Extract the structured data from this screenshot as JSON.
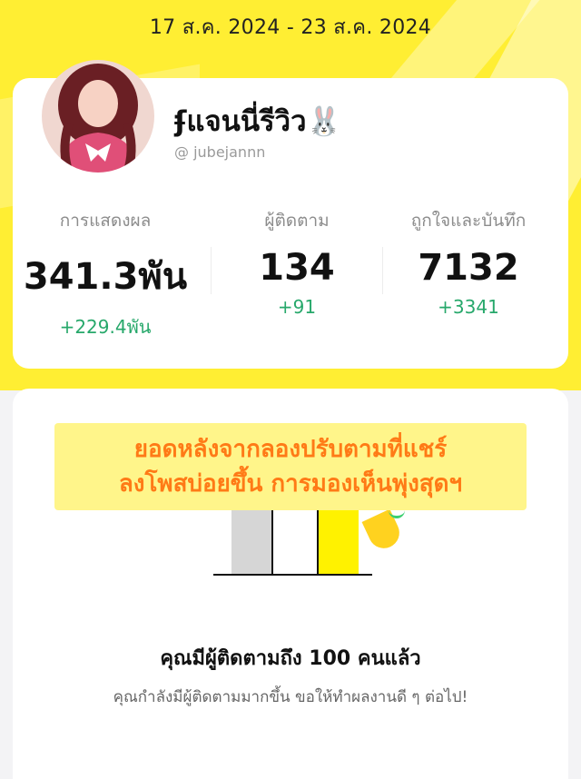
{
  "header": {
    "date_range": "17 ส.ค. 2024 - 23 ส.ค. 2024"
  },
  "profile": {
    "display_name": "ʄแจนนี่รีวิว🐰",
    "handle": "@ jubejannn"
  },
  "stats": [
    {
      "label": "การแสดงผล",
      "value": "341.3พัน",
      "delta": "+229.4พัน"
    },
    {
      "label": "ผู้ติดตาม",
      "value": "134",
      "delta": "+91"
    },
    {
      "label": "ถูกใจและบันทึก",
      "value": "7132",
      "delta": "+3341"
    }
  ],
  "milestone": {
    "banner_line1": "ยอดหลังจากลองปรับตามที่แชร์",
    "banner_line2": "ลงโพสบ่อยขึ้น การมองเห็นพุ่งสุดฯ",
    "title": "คุณมีผู้ติดตามถึง 100 คนแล้ว",
    "subtitle": "คุณกำลังมีผู้ติดตามมากขึ้น ขอให้ทำผลงานดี ๆ ต่อไป!"
  },
  "colors": {
    "accent_yellow": "#ffee33",
    "delta_green": "#27a86b",
    "banner_text": "#ff7a16",
    "banner_bg": "#fff58a"
  }
}
